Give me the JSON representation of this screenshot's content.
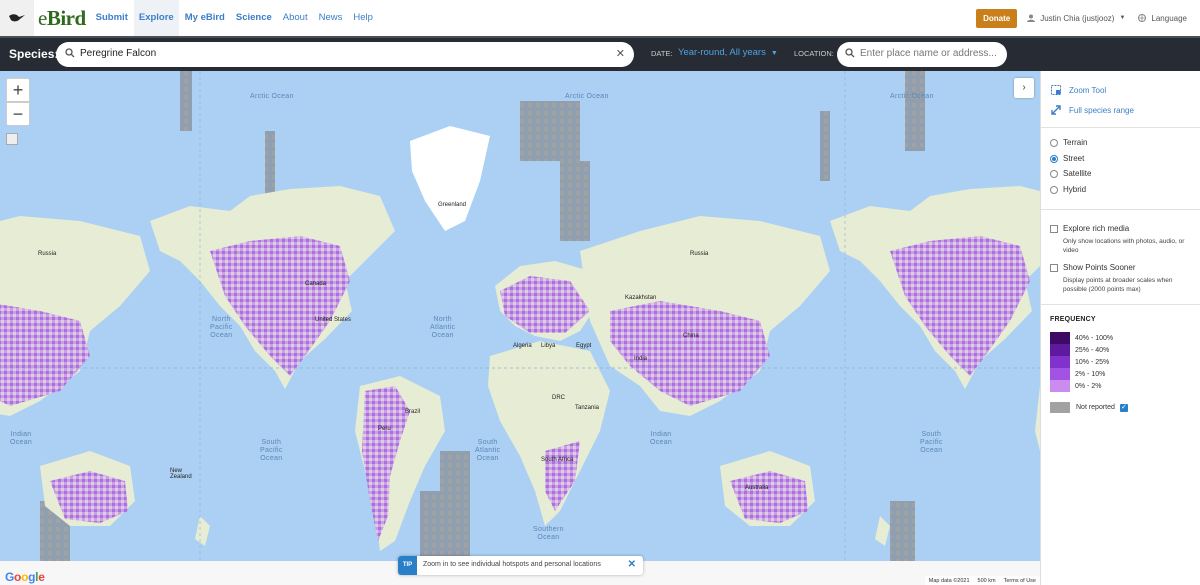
{
  "brand": {
    "name_prefix": "e",
    "name_suffix": "Bird"
  },
  "nav": {
    "items": [
      {
        "label": "Submit",
        "bold": true,
        "active": false
      },
      {
        "label": "Explore",
        "bold": true,
        "active": true
      },
      {
        "label": "My eBird",
        "bold": true,
        "active": false
      },
      {
        "label": "Science",
        "bold": true,
        "active": false
      },
      {
        "label": "About",
        "bold": false,
        "active": false
      },
      {
        "label": "News",
        "bold": false,
        "active": false
      },
      {
        "label": "Help",
        "bold": false,
        "active": false
      }
    ],
    "donate_label": "Donate",
    "user_label": "Justin Chia (justjooz)",
    "language_label": "Language"
  },
  "search": {
    "species_label": "Species:",
    "species_value": "Peregrine Falcon",
    "date_label": "DATE:",
    "date_value": "Year-round, All years",
    "location_label": "LOCATION:",
    "location_placeholder": "Enter place name or address..."
  },
  "map": {
    "labels": {
      "arctic_ocean": "Arctic Ocean",
      "greenland": "Greenland",
      "north_pacific": "North\nPacific\nOcean",
      "north_atlantic": "North\nAtlantic\nOcean",
      "south_pacific": "South\nPacific\nOcean",
      "south_atlantic": "South\nAtlantic\nOcean",
      "indian_ocean": "Indian\nOcean",
      "southern_ocean": "Southern\nOcean",
      "russia": "Russia",
      "kazakhstan": "Kazakhstan",
      "china": "China",
      "algeria": "Algeria",
      "libya": "Libya",
      "egypt": "Egypt",
      "india": "India",
      "brazil": "Brazil",
      "peru": "Peru",
      "drc": "DRC",
      "tanzania": "Tanzania",
      "south_africa": "South Africa",
      "australia": "Australia",
      "new_zealand": "New\nZealand",
      "united_states": "United States",
      "canada": "Canada"
    },
    "tip_badge": "TIP",
    "tip_text": "Zoom in to see individual hotspots and personal locations",
    "footer_map_data": "Map data ©2021",
    "footer_scale": "500 km",
    "footer_terms": "Terms of Use",
    "google_logo": "Google"
  },
  "panel": {
    "zoom_tool_label": "Zoom Tool",
    "full_range_label": "Full species range",
    "map_types": [
      {
        "label": "Terrain",
        "selected": false
      },
      {
        "label": "Street",
        "selected": true
      },
      {
        "label": "Satellite",
        "selected": false
      },
      {
        "label": "Hybrid",
        "selected": false
      }
    ],
    "rich_media_label": "Explore rich media",
    "rich_media_desc": "Only show locations with photos, audio, or video",
    "points_sooner_label": "Show Points Sooner",
    "points_sooner_desc": "Display points at broader scales when possible (2000 points max)",
    "frequency_title": "FREQUENCY",
    "legend": [
      {
        "label": "40% - 100%",
        "color": "#3d0b66"
      },
      {
        "label": "25% - 40%",
        "color": "#5e1a9c"
      },
      {
        "label": "10% - 25%",
        "color": "#8131cc"
      },
      {
        "label": "2% - 10%",
        "color": "#a253e4"
      },
      {
        "label": "0% - 2%",
        "color": "#cb8cf0"
      }
    ],
    "not_reported_label": "Not reported",
    "not_reported_color": "#a2a2a2"
  },
  "colors": {
    "ocean": "#abd0f3",
    "land": "#e7ecd4",
    "freq_light": "#c18ee6",
    "brand_green": "#2f6a1e",
    "link_blue": "#3c7ec7"
  }
}
